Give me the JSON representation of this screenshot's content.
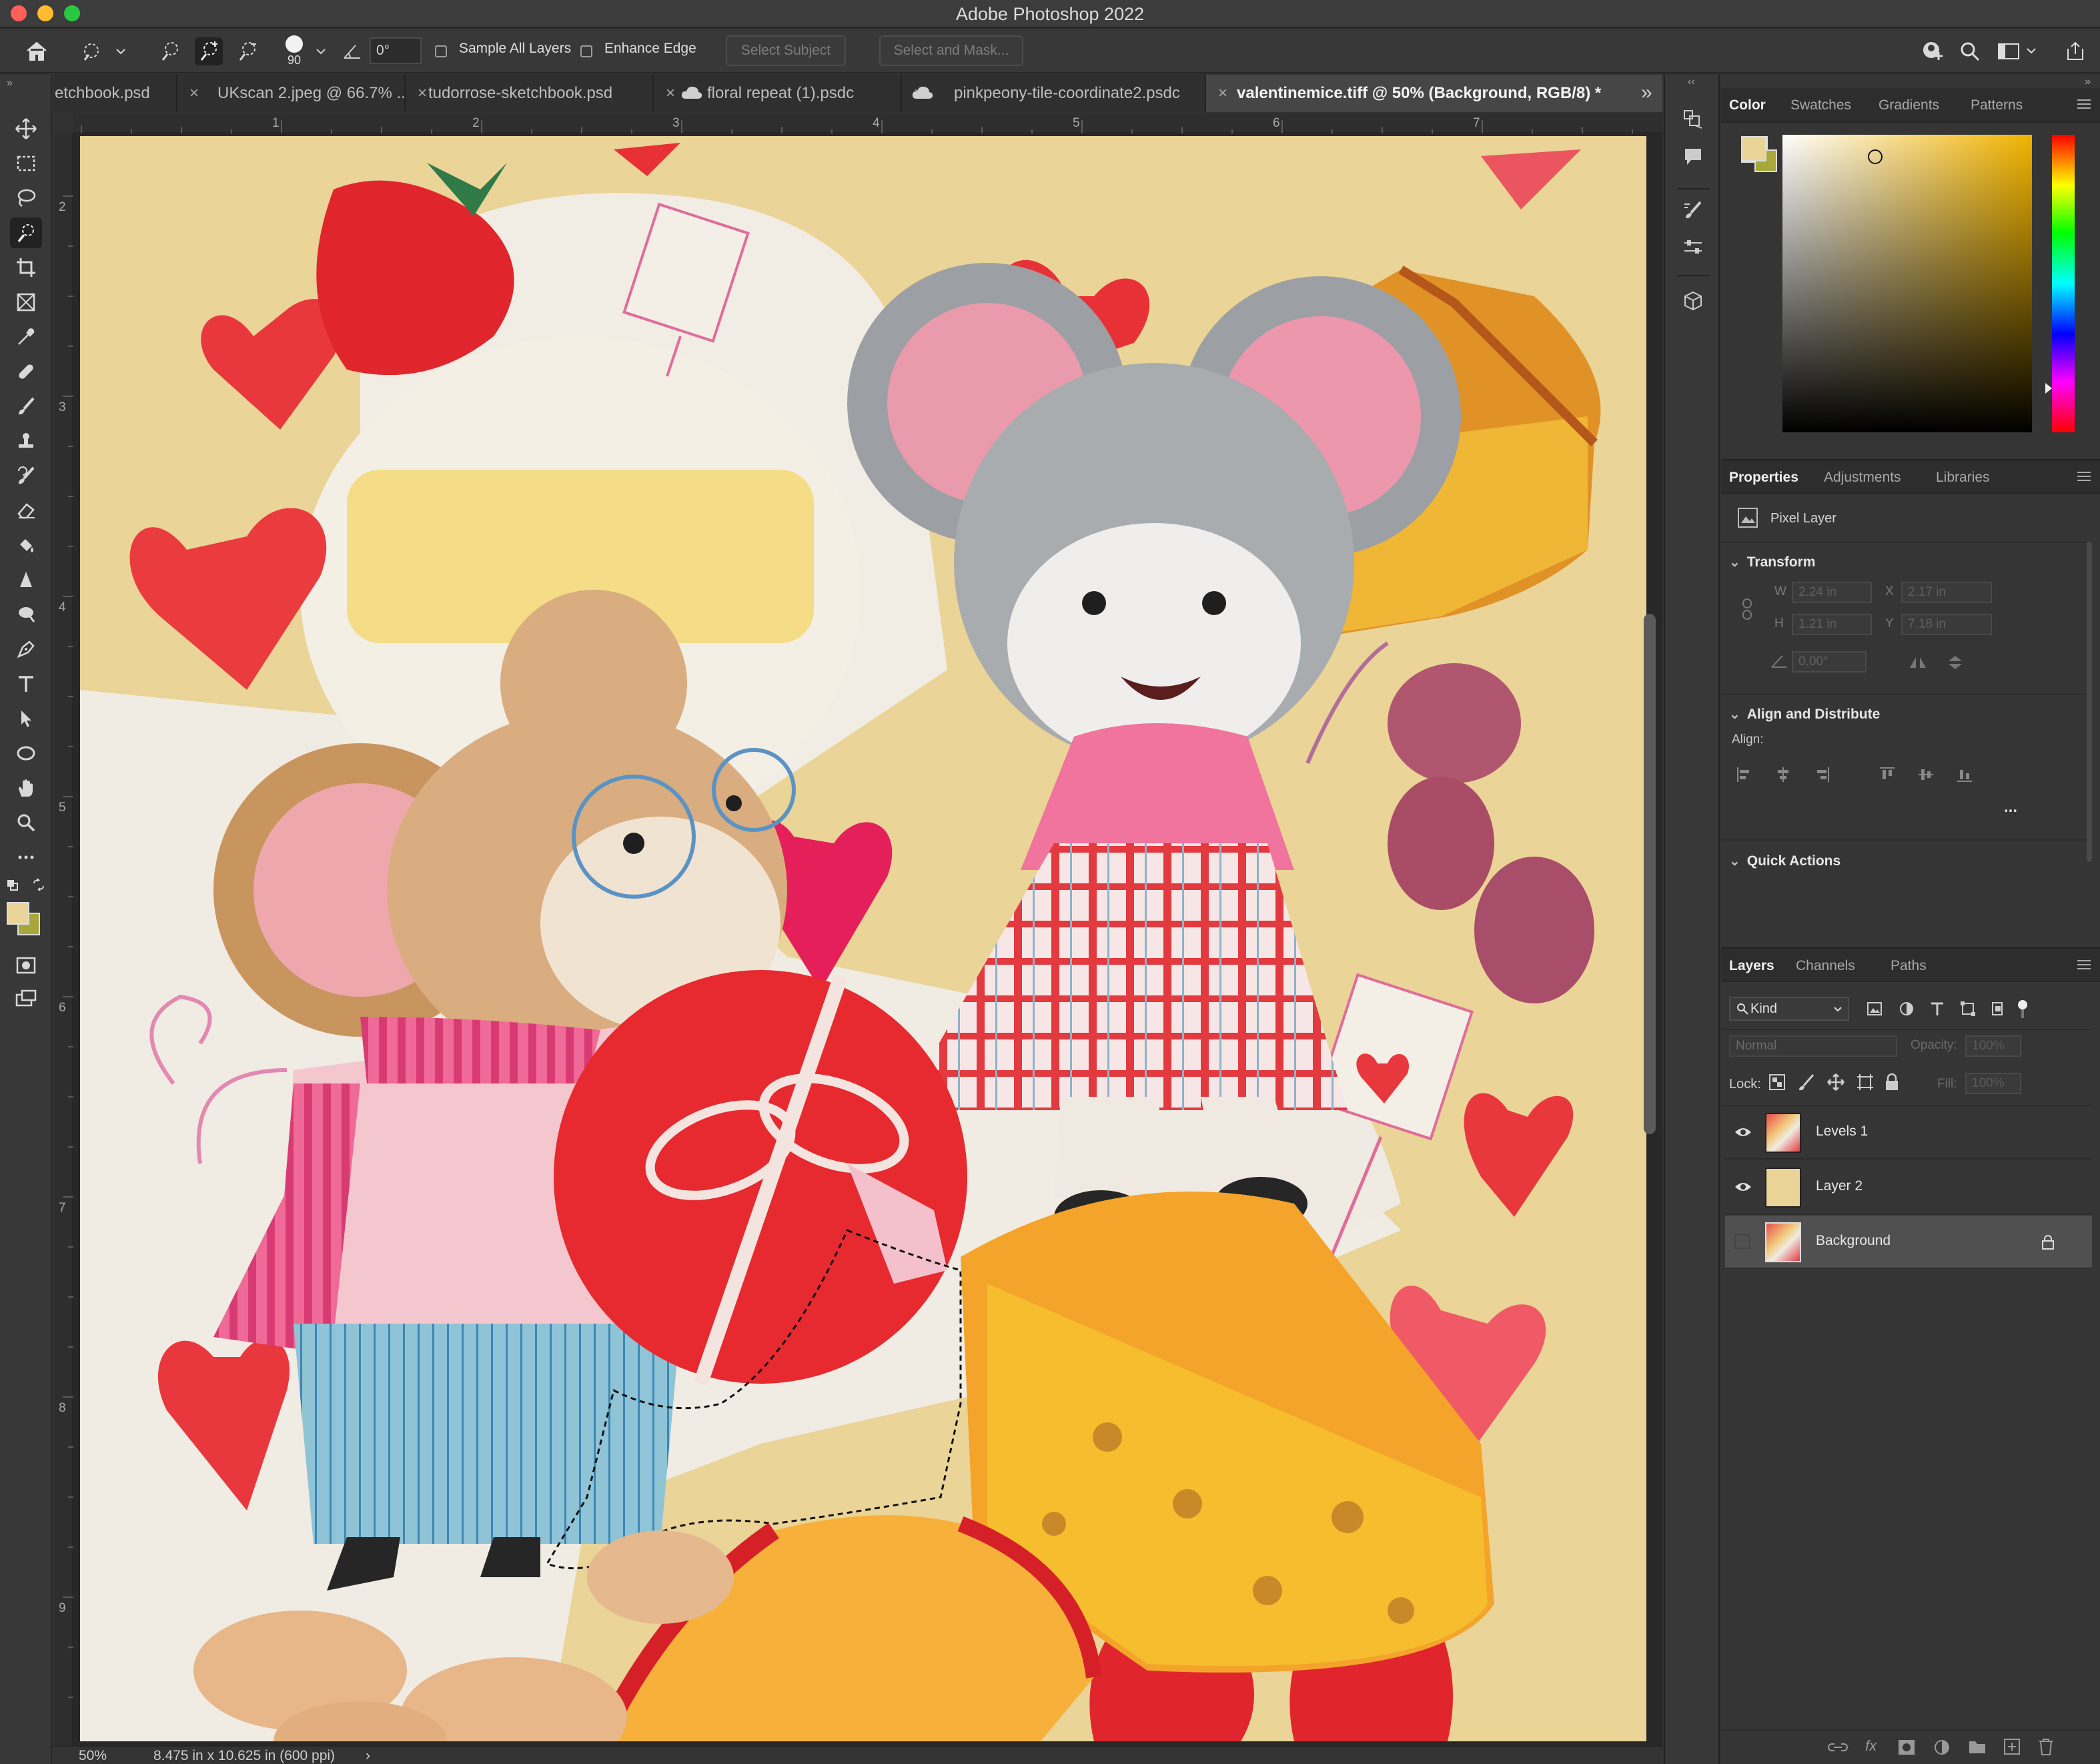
{
  "app": {
    "title": "Adobe Photoshop 2022"
  },
  "options_bar": {
    "brush_size": "90",
    "angle": "0°",
    "sample_all_layers": "Sample All Layers",
    "enhance_edge": "Enhance Edge",
    "select_subject": "Select Subject",
    "select_and_mask": "Select and Mask..."
  },
  "tabs": [
    {
      "label": "etchbook.psd"
    },
    {
      "label": "UKscan 2.jpeg @ 66.7% ..."
    },
    {
      "label": "tudorrose-sketchbook.psd"
    },
    {
      "label": "floral repeat (1).psdc"
    },
    {
      "label": "pinkpeony-tile-coordinate2.psdc"
    },
    {
      "label": "valentinemice.tiff @ 50% (Background, RGB/8) *"
    }
  ],
  "rulers": {
    "h": [
      "1",
      "2",
      "3",
      "4",
      "5",
      "6",
      "7"
    ],
    "v": [
      "2",
      "3",
      "4",
      "5",
      "6",
      "7",
      "8",
      "9"
    ]
  },
  "status": {
    "zoom": "50%",
    "doc_info": "8.475 in x 10.625 in (600 ppi)",
    "arrow": "›"
  },
  "color_panel": {
    "tabs": [
      "Color",
      "Swatches",
      "Gradients",
      "Patterns"
    ],
    "foreground": "#ead497",
    "background": "#a8a83a"
  },
  "properties_panel": {
    "tabs": [
      "Properties",
      "Adjustments",
      "Libraries"
    ],
    "layer_kind": "Pixel Layer",
    "transform_title": "Transform",
    "w_label": "W",
    "w": "2.24 in",
    "x_label": "X",
    "x": "2.17 in",
    "h_label": "H",
    "h": "1.21 in",
    "y_label": "Y",
    "y": "7.18 in",
    "angle": "0.00°",
    "align_title": "Align and Distribute",
    "align_label": "Align:",
    "more": "...",
    "quick_actions": "Quick Actions"
  },
  "layers_panel": {
    "tabs": [
      "Layers",
      "Channels",
      "Paths"
    ],
    "filter_kind": "Kind",
    "blend_mode": "Normal",
    "opacity_label": "Opacity:",
    "opacity": "100%",
    "lock_label": "Lock:",
    "fill_label": "Fill:",
    "fill": "100%",
    "layers": [
      {
        "name": "Levels 1",
        "visible": true,
        "selected": false
      },
      {
        "name": "Layer 2",
        "visible": true,
        "selected": false
      },
      {
        "name": "Background",
        "visible": false,
        "selected": true,
        "locked": true
      }
    ]
  }
}
